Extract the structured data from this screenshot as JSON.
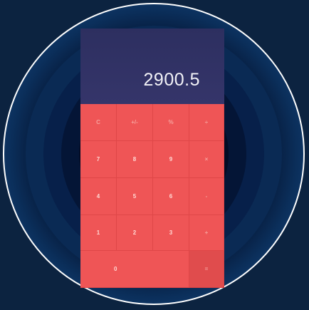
{
  "display": {
    "value": "2900.5"
  },
  "keys": {
    "row1": [
      "C",
      "+/-",
      "%",
      "÷"
    ],
    "row2": [
      "7",
      "8",
      "9",
      "×"
    ],
    "row3": [
      "4",
      "5",
      "6",
      "-"
    ],
    "row4": [
      "1",
      "2",
      "3",
      "+"
    ],
    "row5": [
      "0",
      "="
    ]
  },
  "colors": {
    "background": "#0c2340",
    "display": "#2d2f60",
    "keypad": "#ef5556",
    "display_text": "#f2f2f7"
  }
}
